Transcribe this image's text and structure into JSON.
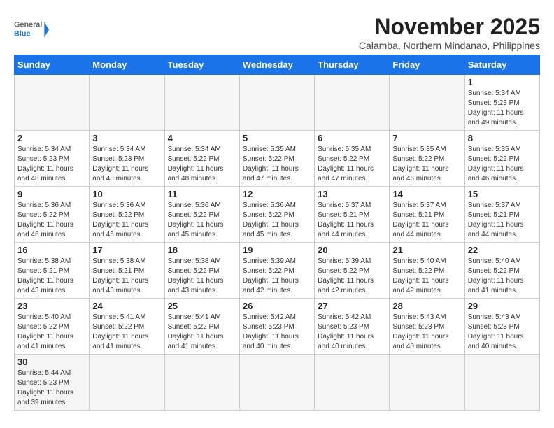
{
  "header": {
    "logo_text_general": "General",
    "logo_text_blue": "Blue",
    "month_title": "November 2025",
    "location": "Calamba, Northern Mindanao, Philippines"
  },
  "weekdays": [
    "Sunday",
    "Monday",
    "Tuesday",
    "Wednesday",
    "Thursday",
    "Friday",
    "Saturday"
  ],
  "weeks": [
    [
      {
        "day": "",
        "empty": true
      },
      {
        "day": "",
        "empty": true
      },
      {
        "day": "",
        "empty": true
      },
      {
        "day": "",
        "empty": true
      },
      {
        "day": "",
        "empty": true
      },
      {
        "day": "",
        "empty": true
      },
      {
        "day": "1",
        "sunrise": "5:34 AM",
        "sunset": "5:23 PM",
        "daylight": "11 hours and 49 minutes."
      }
    ],
    [
      {
        "day": "2",
        "sunrise": "5:34 AM",
        "sunset": "5:23 PM",
        "daylight": "11 hours and 48 minutes."
      },
      {
        "day": "3",
        "sunrise": "5:34 AM",
        "sunset": "5:23 PM",
        "daylight": "11 hours and 48 minutes."
      },
      {
        "day": "4",
        "sunrise": "5:34 AM",
        "sunset": "5:22 PM",
        "daylight": "11 hours and 48 minutes."
      },
      {
        "day": "5",
        "sunrise": "5:35 AM",
        "sunset": "5:22 PM",
        "daylight": "11 hours and 47 minutes."
      },
      {
        "day": "6",
        "sunrise": "5:35 AM",
        "sunset": "5:22 PM",
        "daylight": "11 hours and 47 minutes."
      },
      {
        "day": "7",
        "sunrise": "5:35 AM",
        "sunset": "5:22 PM",
        "daylight": "11 hours and 46 minutes."
      },
      {
        "day": "8",
        "sunrise": "5:35 AM",
        "sunset": "5:22 PM",
        "daylight": "11 hours and 46 minutes."
      }
    ],
    [
      {
        "day": "9",
        "sunrise": "5:36 AM",
        "sunset": "5:22 PM",
        "daylight": "11 hours and 46 minutes."
      },
      {
        "day": "10",
        "sunrise": "5:36 AM",
        "sunset": "5:22 PM",
        "daylight": "11 hours and 45 minutes."
      },
      {
        "day": "11",
        "sunrise": "5:36 AM",
        "sunset": "5:22 PM",
        "daylight": "11 hours and 45 minutes."
      },
      {
        "day": "12",
        "sunrise": "5:36 AM",
        "sunset": "5:22 PM",
        "daylight": "11 hours and 45 minutes."
      },
      {
        "day": "13",
        "sunrise": "5:37 AM",
        "sunset": "5:21 PM",
        "daylight": "11 hours and 44 minutes."
      },
      {
        "day": "14",
        "sunrise": "5:37 AM",
        "sunset": "5:21 PM",
        "daylight": "11 hours and 44 minutes."
      },
      {
        "day": "15",
        "sunrise": "5:37 AM",
        "sunset": "5:21 PM",
        "daylight": "11 hours and 44 minutes."
      }
    ],
    [
      {
        "day": "16",
        "sunrise": "5:38 AM",
        "sunset": "5:21 PM",
        "daylight": "11 hours and 43 minutes."
      },
      {
        "day": "17",
        "sunrise": "5:38 AM",
        "sunset": "5:21 PM",
        "daylight": "11 hours and 43 minutes."
      },
      {
        "day": "18",
        "sunrise": "5:38 AM",
        "sunset": "5:22 PM",
        "daylight": "11 hours and 43 minutes."
      },
      {
        "day": "19",
        "sunrise": "5:39 AM",
        "sunset": "5:22 PM",
        "daylight": "11 hours and 42 minutes."
      },
      {
        "day": "20",
        "sunrise": "5:39 AM",
        "sunset": "5:22 PM",
        "daylight": "11 hours and 42 minutes."
      },
      {
        "day": "21",
        "sunrise": "5:40 AM",
        "sunset": "5:22 PM",
        "daylight": "11 hours and 42 minutes."
      },
      {
        "day": "22",
        "sunrise": "5:40 AM",
        "sunset": "5:22 PM",
        "daylight": "11 hours and 41 minutes."
      }
    ],
    [
      {
        "day": "23",
        "sunrise": "5:40 AM",
        "sunset": "5:22 PM",
        "daylight": "11 hours and 41 minutes."
      },
      {
        "day": "24",
        "sunrise": "5:41 AM",
        "sunset": "5:22 PM",
        "daylight": "11 hours and 41 minutes."
      },
      {
        "day": "25",
        "sunrise": "5:41 AM",
        "sunset": "5:22 PM",
        "daylight": "11 hours and 41 minutes."
      },
      {
        "day": "26",
        "sunrise": "5:42 AM",
        "sunset": "5:23 PM",
        "daylight": "11 hours and 40 minutes."
      },
      {
        "day": "27",
        "sunrise": "5:42 AM",
        "sunset": "5:23 PM",
        "daylight": "11 hours and 40 minutes."
      },
      {
        "day": "28",
        "sunrise": "5:43 AM",
        "sunset": "5:23 PM",
        "daylight": "11 hours and 40 minutes."
      },
      {
        "day": "29",
        "sunrise": "5:43 AM",
        "sunset": "5:23 PM",
        "daylight": "11 hours and 40 minutes."
      }
    ],
    [
      {
        "day": "30",
        "sunrise": "5:44 AM",
        "sunset": "5:23 PM",
        "daylight": "11 hours and 39 minutes.",
        "last": true
      },
      {
        "day": "",
        "empty": true,
        "last": true
      },
      {
        "day": "",
        "empty": true,
        "last": true
      },
      {
        "day": "",
        "empty": true,
        "last": true
      },
      {
        "day": "",
        "empty": true,
        "last": true
      },
      {
        "day": "",
        "empty": true,
        "last": true
      },
      {
        "day": "",
        "empty": true,
        "last": true
      }
    ]
  ],
  "labels": {
    "sunrise": "Sunrise:",
    "sunset": "Sunset:",
    "daylight": "Daylight:"
  }
}
